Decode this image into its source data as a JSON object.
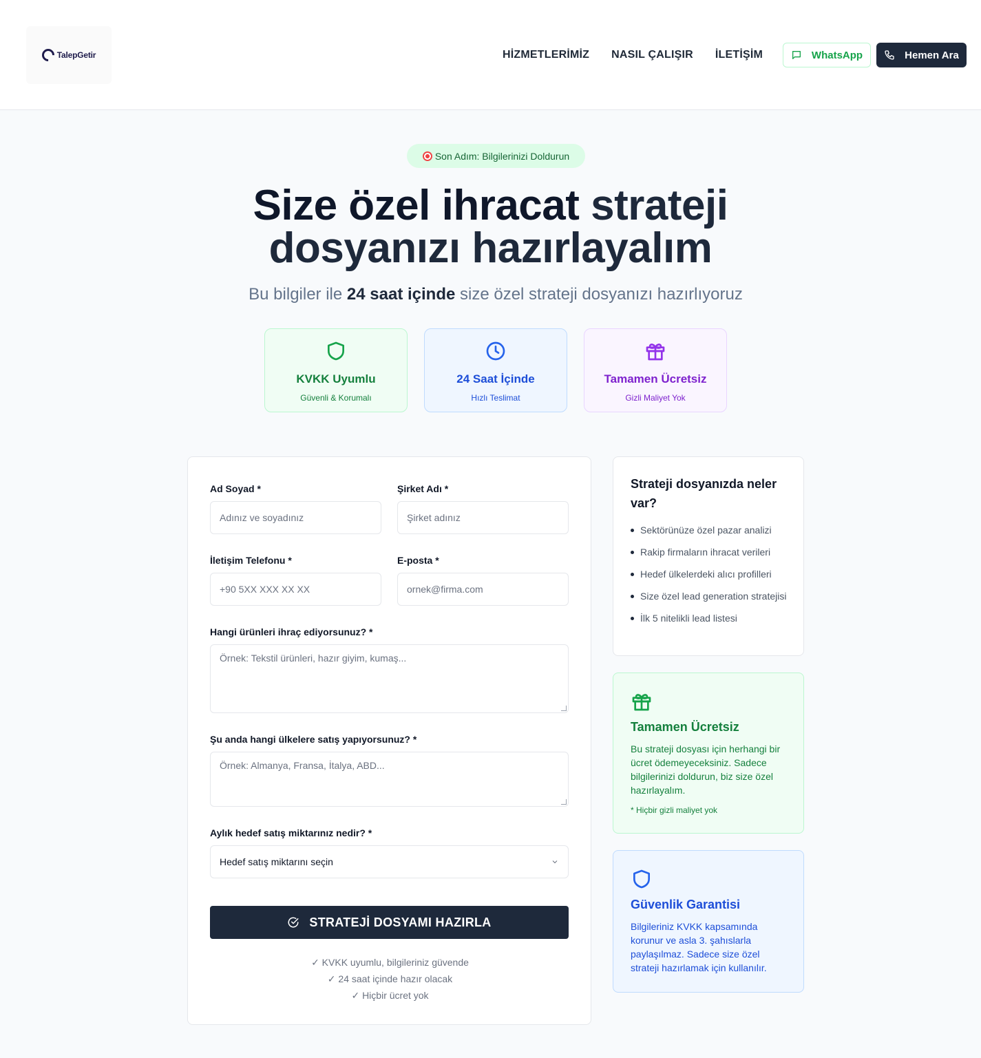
{
  "header": {
    "logo_text": "TalepGetir",
    "nav": [
      "HİZMETLERİMİZ",
      "NASIL ÇALIŞIR",
      "İLETİŞİM"
    ],
    "whatsapp_label": "WhatsApp",
    "call_label": "Hemen Ara"
  },
  "hero": {
    "pill": "Son Adım: Bilgilerinizi Doldurun",
    "title_line1": "Size özel ihracat",
    "title_accent": "strateji",
    "title_line2": "dosyanızı hazırlayalım",
    "sub_pre": "Bu bilgiler ile",
    "sub_bold": "24 saat içinde",
    "sub_post": "size özel strateji dosyanızı hazırlıyoruz",
    "features": [
      {
        "title": "KVKK Uyumlu",
        "subtitle": "Güvenli & Korumalı",
        "icon": "shield-icon",
        "color": "#16a34a"
      },
      {
        "title": "24 Saat İçinde",
        "subtitle": "Hızlı Teslimat",
        "icon": "clock-icon",
        "color": "#2563eb"
      },
      {
        "title": "Tamamen Ücretsiz",
        "subtitle": "Gizli Maliyet Yok",
        "icon": "gift-icon",
        "color": "#9333ea"
      }
    ]
  },
  "form": {
    "name_label": "Ad Soyad *",
    "name_placeholder": "Adınız ve soyadınız",
    "company_label": "Şirket Adı *",
    "company_placeholder": "Şirket adınız",
    "phone_label": "İletişim Telefonu *",
    "phone_placeholder": "+90 5XX XXX XX XX",
    "email_label": "E-posta *",
    "email_placeholder": "ornek@firma.com",
    "products_label": "Hangi ürünleri ihraç ediyorsunuz? *",
    "products_placeholder": "Örnek: Tekstil ürünleri, hazır giyim, kumaş...",
    "countries_label": "Şu anda hangi ülkelere satış yapıyorsunuz? *",
    "countries_placeholder": "Örnek: Almanya, Fransa, İtalya, ABD...",
    "target_label": "Aylık hedef satış miktarınız nedir? *",
    "target_value": "Hedef satış miktarını seçin",
    "submit_label": "STRATEJİ DOSYAMI HAZIRLA",
    "notes": [
      "✓ KVKK uyumlu, bilgileriniz güvende",
      "✓ 24 saat içinde hazır olacak",
      "✓ Hiçbir ücret yok"
    ]
  },
  "sidebar": {
    "contents_title": "Strateji dosyanızda neler var?",
    "contents_items": [
      "Sektörünüze özel pazar analizi",
      "Rakip firmaların ihracat verileri",
      "Hedef ülkelerdeki alıcı profilleri",
      "Size özel lead generation stratejisi",
      "İlk 5 nitelikli lead listesi"
    ],
    "free_title": "Tamamen Ücretsiz",
    "free_text": "Bu strateji dosyası için herhangi bir ücret ödemeyeceksiniz. Sadece bilgilerinizi doldurun, biz size özel hazırlayalım.",
    "free_note": "* Hiçbir gizli maliyet yok",
    "security_title": "Güvenlik Garantisi",
    "security_text": "Bilgileriniz KVKK kapsamında korunur ve asla 3. şahıslarla paylaşılmaz. Sadece size özel strateji hazırlamak için kullanılır."
  }
}
